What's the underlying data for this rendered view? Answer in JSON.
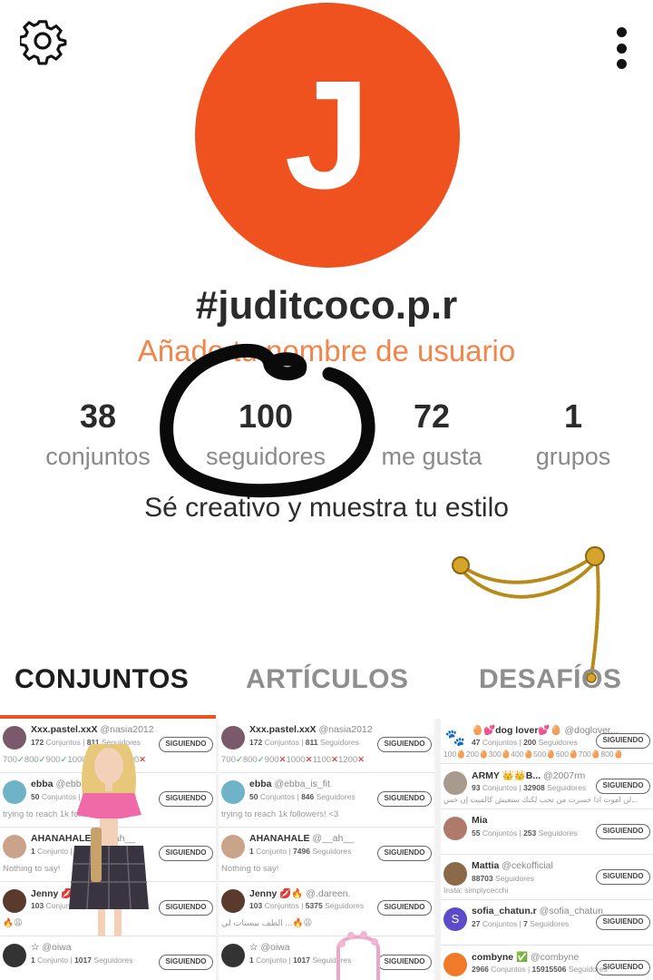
{
  "profile": {
    "avatar_letter": "J",
    "avatar_color": "#f0521f",
    "handle": "#juditcoco.p.r",
    "add_username_prompt": "Añade tu nombre de usuario",
    "bio": "Sé creativo y muestra tu estilo"
  },
  "stats": [
    {
      "value": "38",
      "label": "conjuntos"
    },
    {
      "value": "100",
      "label": "seguidores"
    },
    {
      "value": "72",
      "label": "me gusta"
    },
    {
      "value": "1",
      "label": "grupos"
    }
  ],
  "tabs": [
    {
      "label": "CONJUNTOS",
      "active": true
    },
    {
      "label": "ARTÍCULOS",
      "active": false
    },
    {
      "label": "DESAFÍOS",
      "active": false
    }
  ],
  "accent_color": "#f0521f",
  "feed": {
    "col1": [
      {
        "name": "Xxx.pastel.xxX",
        "at": "@nasia2012",
        "sets": "172",
        "followers": "811",
        "sets_label": "Conjuntos",
        "followers_label": "Seguidores",
        "extra": "700✅800✅900✅1000❌1100❌1200❌",
        "button": "SIGUIENDO"
      },
      {
        "name": "ebba",
        "at": "@ebba_is_fit",
        "sets": "50",
        "followers": "846",
        "sets_label": "Conjuntos",
        "followers_label": "Seguidores",
        "extra": "trying to reach 1k followers! <3",
        "button": "SIGUIENDO"
      },
      {
        "name": "AHANAHALE",
        "at": "@__ah__",
        "sets": "1",
        "followers": "7496",
        "sets_label": "Conjunto",
        "followers_label": "Seguidores",
        "extra": "Nothing to say!",
        "button": "SIGUIENDO"
      },
      {
        "name": "Jenny 💋🔥",
        "at": "@.dareen.",
        "sets": "103",
        "followers": "5375",
        "sets_label": "Conjuntos",
        "followers_label": "Seguidores",
        "extra": "🔥😩",
        "button": "SIGUIENDO"
      },
      {
        "name": "☆",
        "at": "@oiwa",
        "sets": "1",
        "followers": "1017",
        "sets_label": "Conjunto",
        "followers_label": "Seguidores",
        "extra": "",
        "button": "SIGUIENDO"
      }
    ],
    "col2": [
      {
        "name": "Xxx.pastel.xxX",
        "at": "@nasia2012",
        "sets": "172",
        "followers": "811",
        "sets_label": "Conjuntos",
        "followers_label": "Seguidores",
        "extra": "700✅800✅900❌1000❌1100❌1200❌",
        "button": "SIGUIENDO"
      },
      {
        "name": "ebba",
        "at": "@ebba_is_fit",
        "sets": "50",
        "followers": "846",
        "sets_label": "Conjuntos",
        "followers_label": "Seguidores",
        "extra": "trying to reach 1k followers! <3",
        "button": "SIGUIENDO"
      },
      {
        "name": "AHANAHALE",
        "at": "@__ah__",
        "sets": "1",
        "followers": "7496",
        "sets_label": "Conjunto",
        "followers_label": "Seguidores",
        "extra": "Nothing to say!",
        "button": "SIGUIENDO"
      },
      {
        "name": "Jenny 💋🔥",
        "at": "@.dareen.",
        "sets": "103",
        "followers": "5375",
        "sets_label": "Conjuntos",
        "followers_label": "Seguidores",
        "extra": "الطف بيستات لي ...🔥😩",
        "button": "SIGUIENDO"
      },
      {
        "name": "☆",
        "at": "@oiwa",
        "sets": "1",
        "followers": "1017",
        "sets_label": "Conjunto",
        "followers_label": "Seguidores",
        "extra": "",
        "button": "SIGUIENDO"
      }
    ],
    "col3": [
      {
        "name": "🥚💕dog lover💕🥚",
        "at": "@doglover...",
        "sets": "47",
        "followers": "200",
        "sets_label": "Conjuntos",
        "followers_label": "Seguidores",
        "extra": "100🥚200🥚300🥚400🥚500🥚600🥚700🥚800🥚",
        "button": "SIGUIENDO"
      },
      {
        "name": "ARMY 👑👑B...",
        "at": "@2007rm",
        "sets": "93",
        "followers": "32908",
        "sets_label": "Conjuntos",
        "followers_label": "Seguidores",
        "extra": "لن اموت اذا خسرت من تحب لكنك ستعيش كالميت إن خس...",
        "button": "SIGUIENDO"
      },
      {
        "name": "Mia",
        "at": "",
        "sets": "55",
        "followers": "253",
        "sets_label": "Conjuntos",
        "followers_label": "Seguidores",
        "extra": "",
        "button": "SIGUIENDO"
      },
      {
        "name": "Mattia",
        "at": "@cekofficial",
        "sets": "",
        "followers": "88703",
        "sets_label": "",
        "followers_label": "Seguidores",
        "extra": "Insta: simplycecchi",
        "button": "SIGUIENDO"
      },
      {
        "name": "sofia_chatun.r",
        "at": "@sofia_chatun",
        "sets": "27",
        "followers": "7",
        "sets_label": "Conjuntos",
        "followers_label": "Seguidores",
        "extra": "",
        "button": "SIGUIENDO"
      },
      {
        "name": "combyne ✅",
        "at": "@combyne",
        "sets": "2966",
        "followers": "15915506",
        "sets_label": "Conjuntos",
        "followers_label": "Seguidores",
        "extra": "",
        "button": "SIGUIENDO"
      }
    ]
  }
}
